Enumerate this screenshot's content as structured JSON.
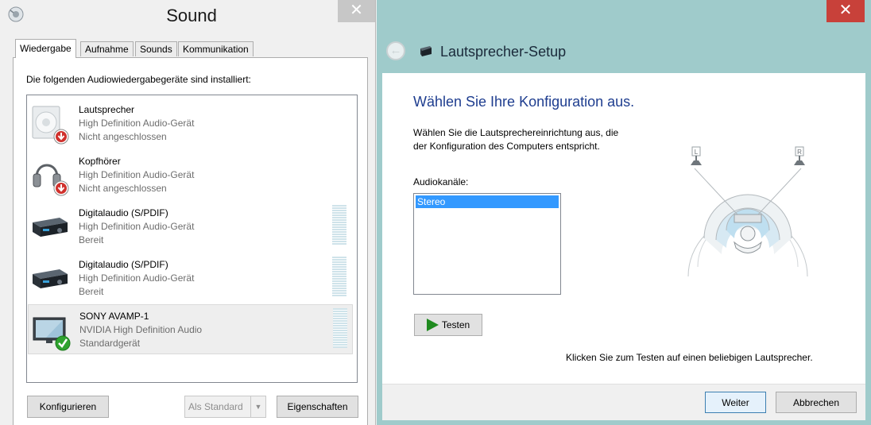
{
  "sound": {
    "title": "Sound",
    "close": "✕",
    "tabs": [
      {
        "label": "Wiedergabe",
        "active": true
      },
      {
        "label": "Aufnahme",
        "active": false
      },
      {
        "label": "Sounds",
        "active": false
      },
      {
        "label": "Kommunikation",
        "active": false
      }
    ],
    "heading": "Die folgenden Audiowiedergabegeräte sind installiert:",
    "devices": [
      {
        "name": "Lautsprecher",
        "driver": "High Definition Audio-Gerät",
        "status": "Nicht angeschlossen",
        "icon": "speaker-icon",
        "badge": "disconnected-badge-icon"
      },
      {
        "name": "Kopfhörer",
        "driver": "High Definition Audio-Gerät",
        "status": "Nicht angeschlossen",
        "icon": "headphones-icon",
        "badge": "disconnected-badge-icon"
      },
      {
        "name": "Digitalaudio (S/PDIF)",
        "driver": "High Definition Audio-Gerät",
        "status": "Bereit",
        "icon": "receiver-icon",
        "level": 0
      },
      {
        "name": "Digitalaudio (S/PDIF)",
        "driver": "High Definition Audio-Gerät",
        "status": "Bereit",
        "icon": "receiver-icon",
        "level": 0
      },
      {
        "name": "SONY AVAMP-1",
        "driver": "NVIDIA High Definition Audio",
        "status": "Standardgerät",
        "icon": "monitor-icon",
        "badge": "default-check-icon",
        "level": 0,
        "selected": true
      }
    ],
    "buttons": {
      "configure": "Konfigurieren",
      "set_default": "Als Standard",
      "properties": "Eigenschaften"
    }
  },
  "setup": {
    "title": "Lautsprecher-Setup",
    "close": "✕",
    "back": "←",
    "heading": "Wählen Sie Ihre Konfiguration aus.",
    "description_line1": "Wählen Sie die Lautsprechereinrichtung aus, die",
    "description_line2": "der Konfiguration des Computers entspricht.",
    "channels_label": "Audiokanäle:",
    "channels": [
      "Stereo"
    ],
    "selected_channel": "Stereo",
    "test_button": "Testen",
    "speaker_labels": {
      "left": "L",
      "right": "R"
    },
    "click_hint": "Klicken Sie zum Testen auf einen beliebigen Lautsprecher.",
    "next_button": "Weiter",
    "cancel_button": "Abbrechen"
  },
  "colors": {
    "heading_blue": "#1e3d8f",
    "selection_blue": "#3399ff",
    "close_red": "#c8413a",
    "frame_teal": "#9fcbcb"
  }
}
